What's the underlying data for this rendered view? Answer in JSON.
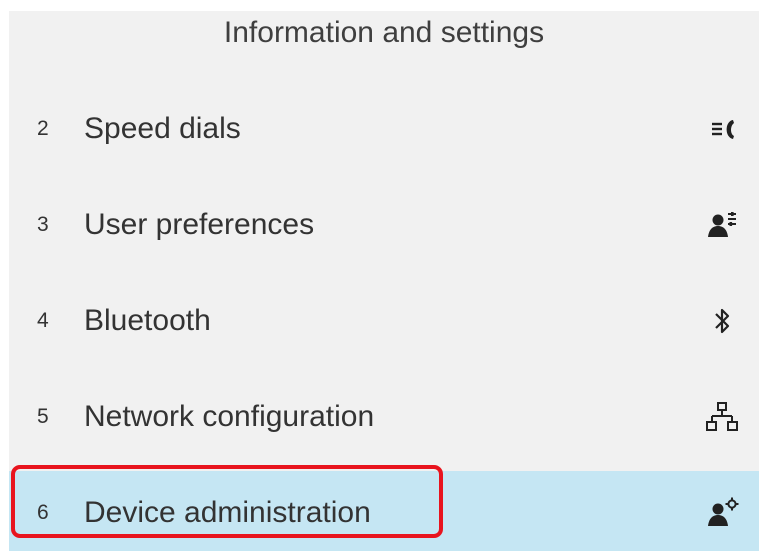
{
  "header": {
    "title": "Information and settings"
  },
  "menu": {
    "items": [
      {
        "number": "2",
        "label": "Speed dials",
        "icon": "speed-dial-icon"
      },
      {
        "number": "3",
        "label": "User preferences",
        "icon": "user-preferences-icon"
      },
      {
        "number": "4",
        "label": "Bluetooth",
        "icon": "bluetooth-icon"
      },
      {
        "number": "5",
        "label": "Network configuration",
        "icon": "network-icon"
      },
      {
        "number": "6",
        "label": "Device administration",
        "icon": "device-admin-icon",
        "selected": true
      }
    ]
  },
  "colors": {
    "screen_background": "#f1f1f1",
    "selected_row": "#c5e6f3",
    "text": "#333333",
    "annotation_outline": "#e8141e"
  }
}
